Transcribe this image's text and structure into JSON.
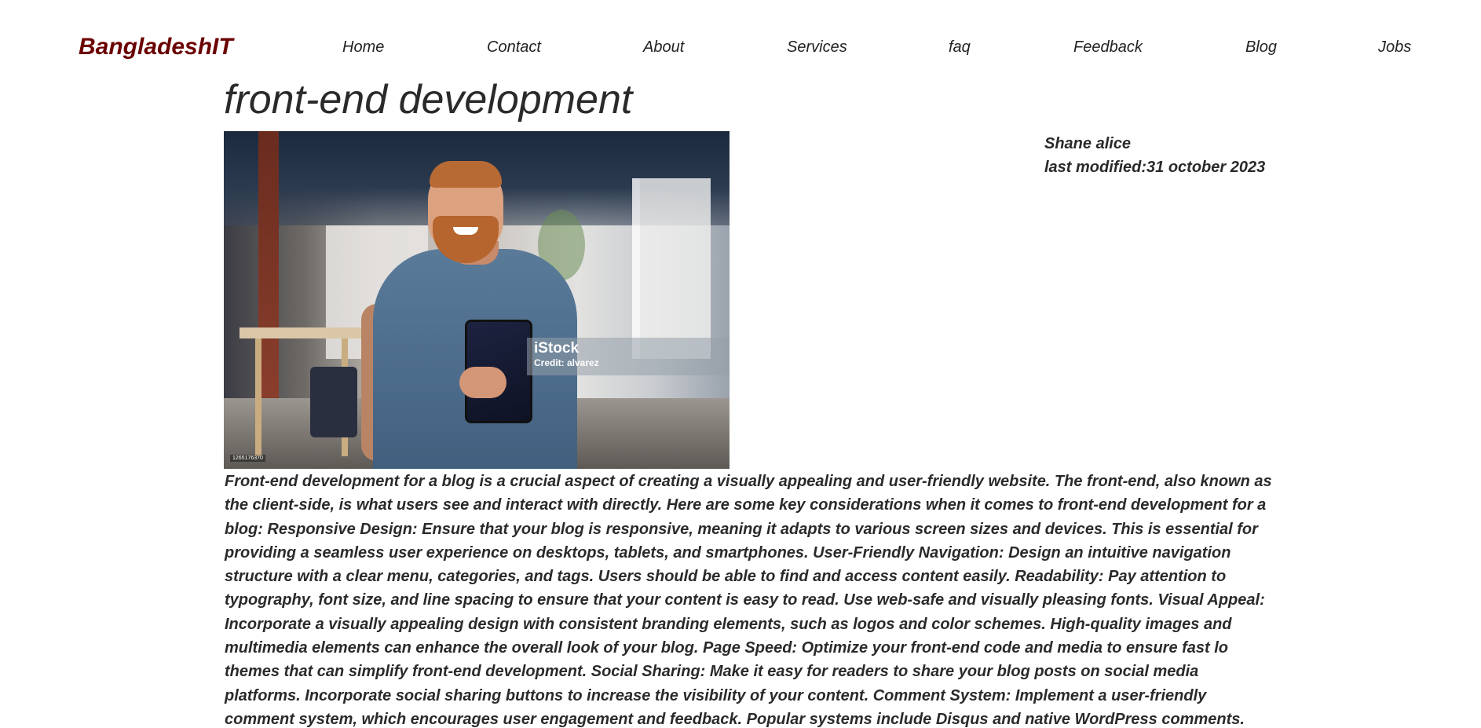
{
  "header": {
    "logo": "BangladeshIT",
    "nav": [
      {
        "label": "Home"
      },
      {
        "label": "Contact"
      },
      {
        "label": "About"
      },
      {
        "label": "Services"
      },
      {
        "label": "faq"
      },
      {
        "label": "Feedback"
      },
      {
        "label": "Blog"
      },
      {
        "label": "Jobs"
      }
    ]
  },
  "article": {
    "title": "front-end development",
    "author": "Shane alice",
    "modified": "last modified:31 october 2023",
    "image": {
      "watermark_brand": "iStock",
      "watermark_credit": "Credit: alvarez",
      "image_id": "1265176370"
    },
    "body": "Front-end development for a blog is a crucial aspect of creating a visually appealing and user-friendly website. The front-end, also known as the client-side, is what users see and interact with directly. Here are some key considerations when it comes to front-end development for a blog: Responsive Design: Ensure that your blog is responsive, meaning it adapts to various screen sizes and devices. This is essential for providing a seamless user experience on desktops, tablets, and smartphones. User-Friendly Navigation: Design an intuitive navigation structure with a clear menu, categories, and tags. Users should be able to find and access content easily. Readability: Pay attention to typography, font size, and line spacing to ensure that your content is easy to read. Use web-safe and visually pleasing fonts. Visual Appeal: Incorporate a visually appealing design with consistent branding elements, such as logos and color schemes. High-quality images and multimedia elements can enhance the overall look of your blog. Page Speed: Optimize your front-end code and media to ensure fast lo themes that can simplify front-end development. Social Sharing: Make it easy for readers to share your blog posts on social media platforms. Incorporate social sharing buttons to increase the visibility of your content. Comment System: Implement a user-friendly comment system, which encourages user engagement and feedback. Popular systems include Disqus and native WordPress comments."
  },
  "colors": {
    "logo": "#6b0000",
    "text": "#2a2a2a",
    "background": "#ffffff"
  }
}
